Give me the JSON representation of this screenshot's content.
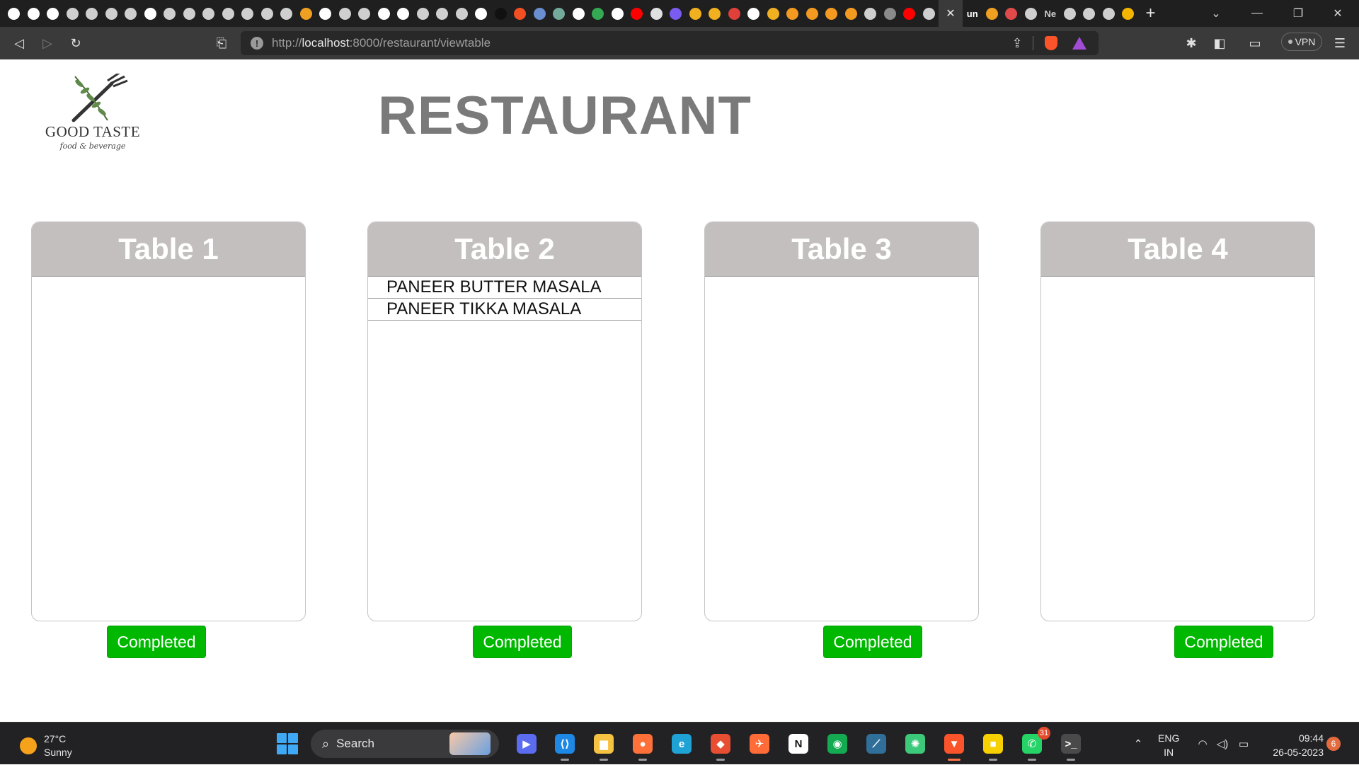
{
  "browser": {
    "tabs": [
      {
        "icon": "github-icon",
        "color": "#ffffff"
      },
      {
        "icon": "github-icon",
        "color": "#ffffff"
      },
      {
        "icon": "google-icon",
        "color": "#ffffff"
      },
      {
        "icon": "globe-icon",
        "color": "#cfcfcf"
      },
      {
        "icon": "globe-icon",
        "color": "#cfcfcf"
      },
      {
        "icon": "globe-icon",
        "color": "#cfcfcf"
      },
      {
        "icon": "globe-icon",
        "color": "#cfcfcf"
      },
      {
        "icon": "google-icon",
        "color": "#ffffff"
      },
      {
        "icon": "crown-icon",
        "color": "#cfcfcf"
      },
      {
        "icon": "globe-icon",
        "color": "#cfcfcf"
      },
      {
        "icon": "globe-icon",
        "color": "#cfcfcf"
      },
      {
        "icon": "globe-icon",
        "color": "#cfcfcf"
      },
      {
        "icon": "globe-icon",
        "color": "#cfcfcf"
      },
      {
        "icon": "globe-icon",
        "color": "#cfcfcf"
      },
      {
        "icon": "globe-icon",
        "color": "#cfcfcf"
      },
      {
        "icon": "codeforces-icon",
        "color": "#f0a020"
      },
      {
        "icon": "github-icon",
        "color": "#ffffff"
      },
      {
        "icon": "globe-icon",
        "color": "#cfcfcf"
      },
      {
        "icon": "globe-icon",
        "color": "#cfcfcf"
      },
      {
        "icon": "google-icon",
        "color": "#ffffff"
      },
      {
        "icon": "google-icon",
        "color": "#ffffff"
      },
      {
        "icon": "globe-icon",
        "color": "#cfcfcf"
      },
      {
        "icon": "globe-icon",
        "color": "#cfcfcf"
      },
      {
        "icon": "globe-icon",
        "color": "#cfcfcf"
      },
      {
        "icon": "github-icon",
        "color": "#ffffff"
      },
      {
        "icon": "dark-icon",
        "color": "#111111"
      },
      {
        "icon": "microsoft-icon",
        "color": "#f25022"
      },
      {
        "icon": "image-icon",
        "color": "#6a8fd0"
      },
      {
        "icon": "chatgpt-icon",
        "color": "#74aa9c"
      },
      {
        "icon": "google-icon",
        "color": "#ffffff"
      },
      {
        "icon": "drive-icon",
        "color": "#34a853"
      },
      {
        "icon": "google-icon",
        "color": "#ffffff"
      },
      {
        "icon": "youtube-icon",
        "color": "#ff0000"
      },
      {
        "icon": "history-icon",
        "color": "#e0e0e0"
      },
      {
        "icon": "list-icon",
        "color": "#7a5cf0"
      },
      {
        "icon": "code-icon",
        "color": "#f0b020"
      },
      {
        "icon": "code-icon",
        "color": "#f0b020"
      },
      {
        "icon": "play-icon",
        "color": "#e0403a"
      },
      {
        "icon": "github-icon",
        "color": "#ffffff"
      },
      {
        "icon": "code-icon",
        "color": "#f0b020"
      },
      {
        "icon": "gear-orange-icon",
        "color": "#f59a20"
      },
      {
        "icon": "gear-orange-icon",
        "color": "#f59a20"
      },
      {
        "icon": "gear-orange-icon",
        "color": "#f59a20"
      },
      {
        "icon": "gear-orange-icon",
        "color": "#f59a20"
      },
      {
        "icon": "globe-icon",
        "color": "#cfcfcf"
      },
      {
        "icon": "minus-circle-icon",
        "color": "#8a8a8a"
      },
      {
        "icon": "youtube-icon",
        "color": "#ff0000"
      },
      {
        "icon": "globe-icon",
        "color": "#cfcfcf"
      }
    ],
    "active_tab_icon": "close-icon",
    "tabs_after": [
      {
        "icon": "unstop-icon",
        "label": "un",
        "color": "#ffffff"
      },
      {
        "icon": "mascot-icon",
        "label": "",
        "color": "#f0a020"
      },
      {
        "icon": "design-icon",
        "label": "",
        "color": "#e04a4a"
      },
      {
        "icon": "globe-icon",
        "label": "",
        "color": "#cfcfcf"
      },
      {
        "icon": "notion-icon",
        "label": "Ne",
        "color": "#cfcfcf"
      },
      {
        "icon": "globe-icon",
        "label": "",
        "color": "#cfcfcf"
      },
      {
        "icon": "globe-icon",
        "label": "",
        "color": "#cfcfcf"
      },
      {
        "icon": "globe-icon",
        "label": "",
        "color": "#cfcfcf"
      },
      {
        "icon": "slides-icon",
        "label": "",
        "color": "#f4b400"
      }
    ],
    "new_tab_label": "+",
    "url_scheme": "http://",
    "url_host": "localhost",
    "url_path": ":8000/restaurant/viewtable",
    "vpn_label": "VPN"
  },
  "page": {
    "logo": {
      "brand": "GOOD TASTE",
      "tagline": "food & beverage"
    },
    "title": "RESTAURANT",
    "tables": [
      {
        "name": "Table 1",
        "orders": [],
        "button_label": "Completed"
      },
      {
        "name": "Table 2",
        "orders": [
          "PANEER BUTTER MASALA",
          "PANEER TIKKA MASALA"
        ],
        "button_label": "Completed"
      },
      {
        "name": "Table 3",
        "orders": [],
        "button_label": "Completed"
      },
      {
        "name": "Table 4",
        "orders": [],
        "button_label": "Completed"
      }
    ],
    "colors": {
      "header_bg": "#c3bfbf",
      "button_bg": "#00b800",
      "title": "#7a7a7a"
    }
  },
  "taskbar": {
    "weather": {
      "temp": "27°C",
      "condition": "Sunny"
    },
    "search_label": "Search",
    "apps": [
      {
        "name": "zoom-icon",
        "color": "#5b6cf0",
        "glyph": "▶"
      },
      {
        "name": "vscode-icon",
        "color": "#1e88e5",
        "glyph": "⟨⟩"
      },
      {
        "name": "file-explorer-icon",
        "color": "#f5c242",
        "glyph": "▆"
      },
      {
        "name": "firefox-icon",
        "color": "#ff7139",
        "glyph": "●"
      },
      {
        "name": "edge-icon",
        "color": "#1fa2d6",
        "glyph": "e"
      },
      {
        "name": "git-icon",
        "color": "#e84e31",
        "glyph": "◆"
      },
      {
        "name": "postman-icon",
        "color": "#ff6c37",
        "glyph": "✈"
      },
      {
        "name": "notion-icon",
        "color": "#ffffff",
        "glyph": "N"
      },
      {
        "name": "mongodb-icon",
        "color": "#13aa52",
        "glyph": "◉"
      },
      {
        "name": "mysql-workbench-icon",
        "color": "#2f6f99",
        "glyph": "⟋"
      },
      {
        "name": "atom-icon",
        "color": "#3cc97a",
        "glyph": "✺"
      },
      {
        "name": "brave-icon",
        "color": "#fb542b",
        "glyph": "▼"
      },
      {
        "name": "sticky-notes-icon",
        "color": "#f7d000",
        "glyph": "■"
      },
      {
        "name": "whatsapp-icon",
        "color": "#25d366",
        "glyph": "✆"
      },
      {
        "name": "terminal-icon",
        "color": "#4a4a4a",
        "glyph": ">_"
      }
    ],
    "whatsapp_badge": "31",
    "language": {
      "line1": "ENG",
      "line2": "IN"
    },
    "time": "09:44",
    "date": "26-05-2023",
    "notification_count": "6"
  }
}
